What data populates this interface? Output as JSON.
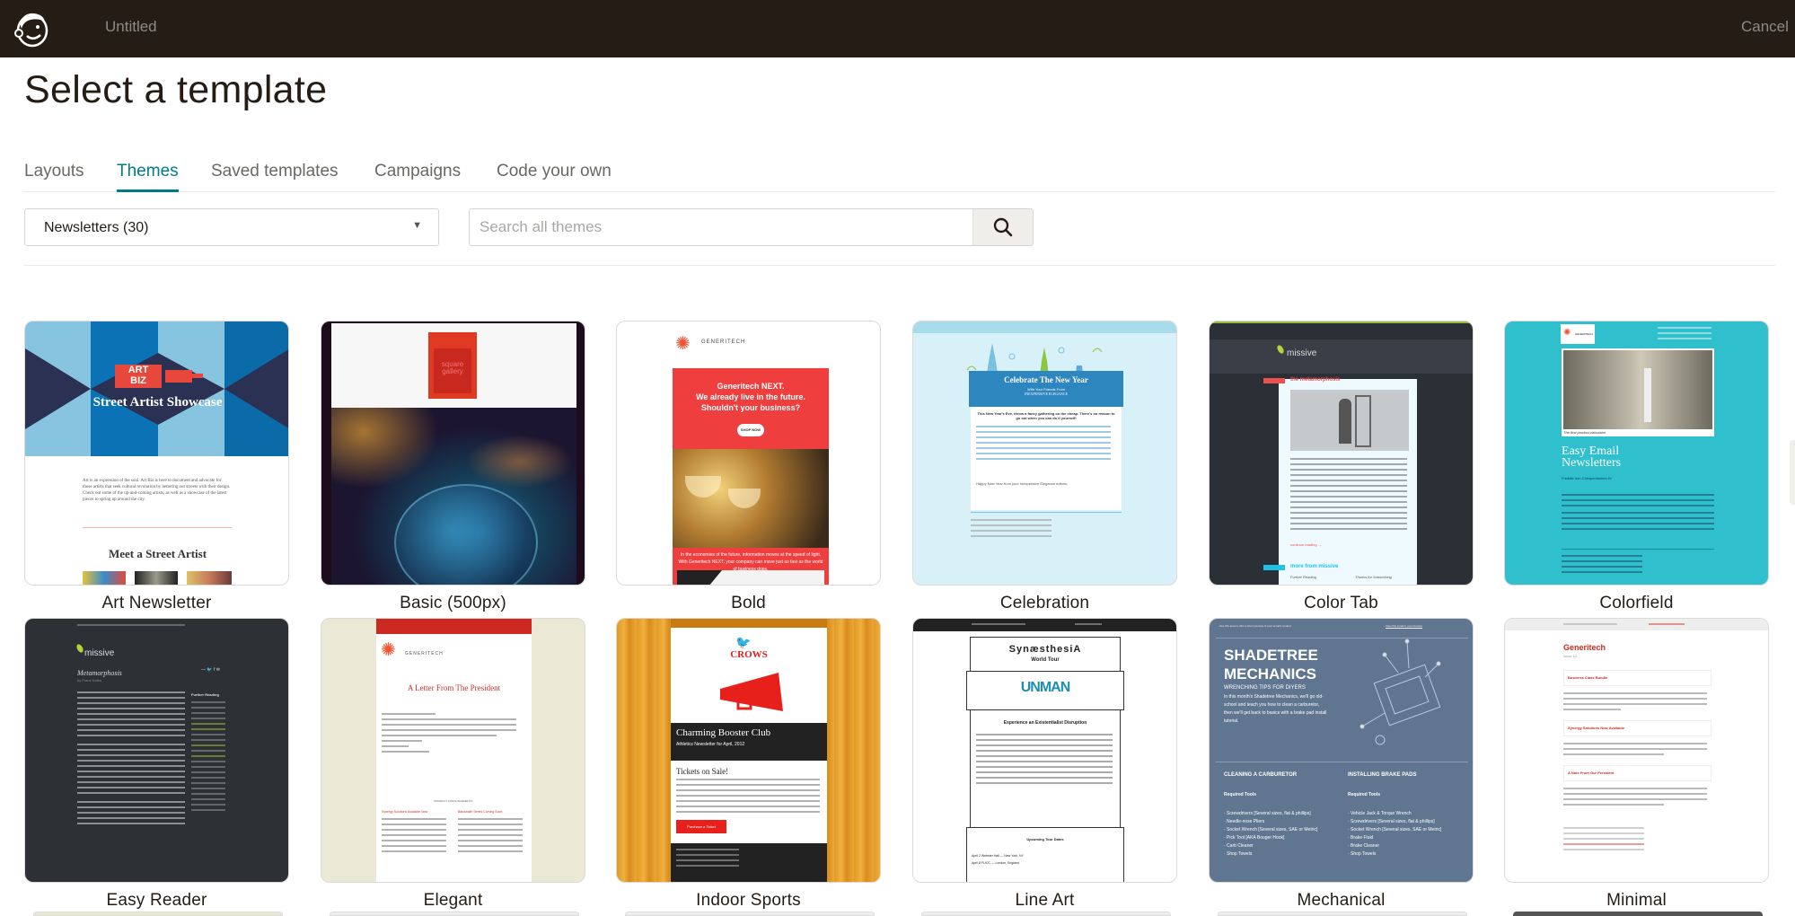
{
  "header": {
    "logo": "mailchimp-freddie-logo",
    "document_title": "Untitled",
    "cancel_label": "Cancel"
  },
  "page": {
    "title": "Select a template"
  },
  "tabs": [
    {
      "label": "Layouts",
      "active": false
    },
    {
      "label": "Themes",
      "active": true
    },
    {
      "label": "Saved templates",
      "active": false
    },
    {
      "label": "Campaigns",
      "active": false
    },
    {
      "label": "Code your own",
      "active": false
    }
  ],
  "filters": {
    "category_select": {
      "selected": "Newsletters (30)"
    },
    "search": {
      "value": "",
      "placeholder": "Search all themes",
      "icon": "search-icon"
    }
  },
  "colors": {
    "topbar": "#241c15",
    "accent": "#007c89",
    "text": "#241c15"
  },
  "themes": [
    {
      "name": "Art Newsletter",
      "preview": {
        "logo_text_1": "ART",
        "logo_text_2": "BIZ",
        "headline": "Street Artist Showcase",
        "body": "Art is an expression of the soul. Art Biz is here to document and advocate for those artists that seek cultural revolution by bettering our streets with their design. Check out some of the up-and-coming artists, as well as a showcase of the latest pieces to spring up around the city.",
        "section_title": "Meet a Street Artist"
      }
    },
    {
      "name": "Basic (500px)",
      "preview": {
        "logo_text": "square gallery"
      }
    },
    {
      "name": "Bold",
      "preview": {
        "brand": "GENERITECH",
        "headline_1": "Generitech NEXT.",
        "headline_2": "We already live in the future.",
        "headline_3": "Shouldn't your business?",
        "button": "SHOP NOW",
        "body": "In the economies of the future, information moves at the speed of light. With Generitech NEXT, your company can move just as fast as the world of business does."
      }
    },
    {
      "name": "Celebration",
      "preview": {
        "headline": "Celebrate The New Year",
        "subhead_1": "With Your Friends From",
        "subhead_2": "INEXPENSIVE ELEGANCE",
        "lead": "This New Year's Eve, throw a fancy gathering on the cheap. There's no reason to go out when you can do it yourself!",
        "sign_off": "Happy New Year from your Inexpensive Elegance editors,"
      }
    },
    {
      "name": "Color Tab",
      "preview": {
        "brand": "missive",
        "section_1": "the metamorphosis",
        "link": "continue reading →",
        "section_2": "more from missive",
        "col_1": "Further Reading",
        "col_2": "Thanks for Subscribing"
      }
    },
    {
      "name": "Colorfield",
      "preview": {
        "brand": "GENERITECH",
        "caption": "The first product calculator",
        "headline": "Easy Email Newsletters",
        "byline": "Freddie Von Chimpenheimer IV"
      }
    },
    {
      "name": "Easy Reader",
      "preview": {
        "brand": "missive",
        "headline": "Metamorphosis",
        "byline": "by Franz Kafka",
        "sidebar_title": "Further Reading"
      }
    },
    {
      "name": "Elegant",
      "preview": {
        "brand": "GENERITECH",
        "headline": "A Letter From The President",
        "section": "PRODUCT ANNOUNCEMENTS",
        "col_1": "Synergy Solutions Available Now",
        "col_2": "Bandwidth Series Coming Soon"
      }
    },
    {
      "name": "Indoor Sports",
      "preview": {
        "brand": "CROWS",
        "headline": "Charming Booster Club",
        "subhead": "Athletics Newsletter for April, 2012",
        "section": "Tickets on Sale!",
        "button": "Purchase a Ticket"
      }
    },
    {
      "name": "Line Art",
      "preview": {
        "headline": "SynæsthesiA",
        "subhead": "World Tour",
        "band": "UNMAN",
        "section": "Experience an Existentialist Disruption",
        "dates_title": "Upcoming Tour Dates",
        "date_1": "April 2 Webster Hall — New York, NY",
        "date_2": "April 8 FLICC — London, England"
      }
    },
    {
      "name": "Mechanical",
      "preview": {
        "preheader": "Use this area to offer a short preview of your email's content.",
        "view_link": "View this email in your browser",
        "headline_1": "SHADETREE",
        "headline_2": "MECHANICS",
        "tagline": "WRENCHING TIPS FOR DIYERS",
        "intro": "In this month's Shadetree Mechanics, we'll go old-school and teach you how to clean a carburetor, then we'll get back to basics with a brake pad install tutorial.",
        "col_1_title": "CLEANING A CARBURETOR",
        "col_2_title": "INSTALLING BRAKE PADS",
        "tools_label": "Required Tools",
        "col_1_items": [
          "Screwdrivers [Several sizes, flat & phillips]",
          "Needle-nose Pliers",
          "Socket Wrench [Several sizes, SAE or Metric]",
          "Pick Tool [AKA Booger Hook]",
          "Carb Cleaner",
          "Shop Towels"
        ],
        "col_2_items": [
          "Vehicle Jack & Torque Wrench",
          "Screwdrivers [Several sizes, flat & phillips]",
          "Socket Wrench [Several sizes, SAE or Metric]",
          "Brake Fluid",
          "Brake Cleaner",
          "Shop Towels"
        ]
      }
    },
    {
      "name": "Minimal",
      "preview": {
        "brand": "Generitech",
        "issue": "Issue 12",
        "section_1": "Business Class Bundle",
        "section_2": "Synergy Solutions Now Available",
        "section_3": "A Note From Our President"
      }
    }
  ]
}
